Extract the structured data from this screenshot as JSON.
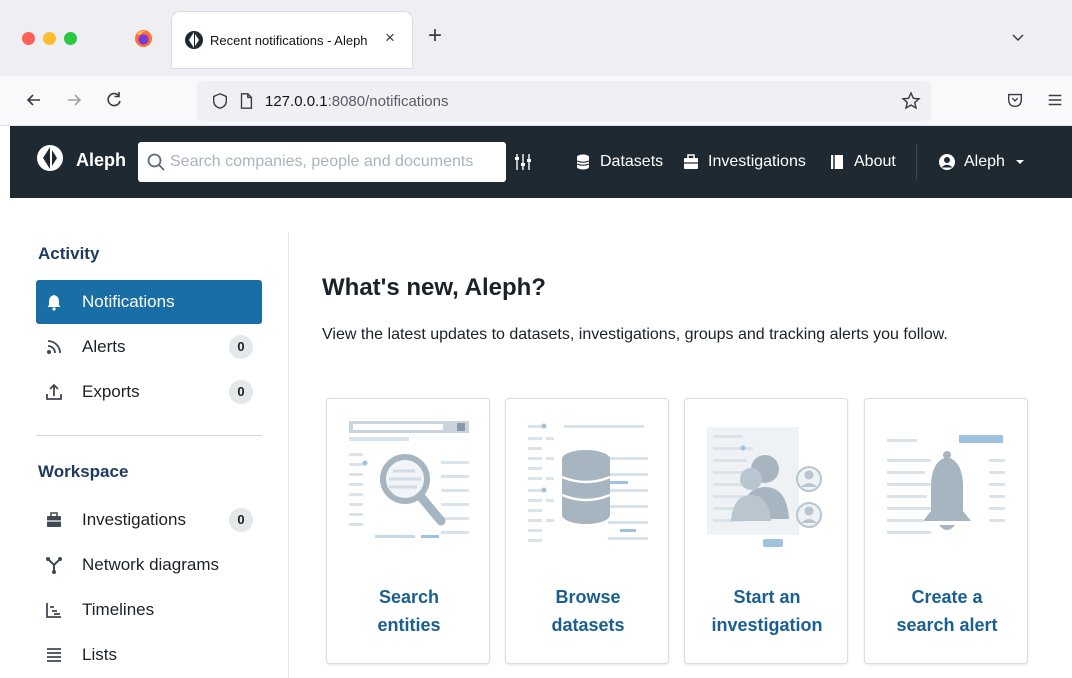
{
  "browser": {
    "tab_title": "Recent notifications - Aleph",
    "tab_close": "×",
    "new_tab": "+",
    "url_host": "127.0.0.1",
    "url_rest": ":8080/notifications"
  },
  "header": {
    "brand": "Aleph",
    "search_placeholder": "Search companies, people and documents",
    "nav": [
      {
        "label": "Datasets",
        "icon": "database-icon"
      },
      {
        "label": "Investigations",
        "icon": "briefcase-icon"
      },
      {
        "label": "About",
        "icon": "book-icon"
      }
    ],
    "user": "Aleph"
  },
  "sidebar": {
    "activity_title": "Activity",
    "activity_items": [
      {
        "label": "Notifications",
        "icon": "bell-icon",
        "active": true
      },
      {
        "label": "Alerts",
        "icon": "feed-icon",
        "count": "0"
      },
      {
        "label": "Exports",
        "icon": "export-icon",
        "count": "0"
      }
    ],
    "workspace_title": "Workspace",
    "workspace_items": [
      {
        "label": "Investigations",
        "icon": "briefcase-icon",
        "count": "0"
      },
      {
        "label": "Network diagrams",
        "icon": "graph-icon"
      },
      {
        "label": "Timelines",
        "icon": "timeline-icon"
      },
      {
        "label": "Lists",
        "icon": "list-icon"
      }
    ]
  },
  "main": {
    "title": "What's new, Aleph?",
    "lead": "View the latest updates to datasets, investigations, groups and tracking alerts you follow.",
    "cards": [
      {
        "label": "Search entities"
      },
      {
        "label": "Browse datasets"
      },
      {
        "label": "Start an investigation"
      },
      {
        "label": "Create a search alert"
      }
    ]
  },
  "colors": {
    "header_bg": "#1e2932",
    "active_bg": "#1a6ea6",
    "card_label": "#1a5f93"
  }
}
